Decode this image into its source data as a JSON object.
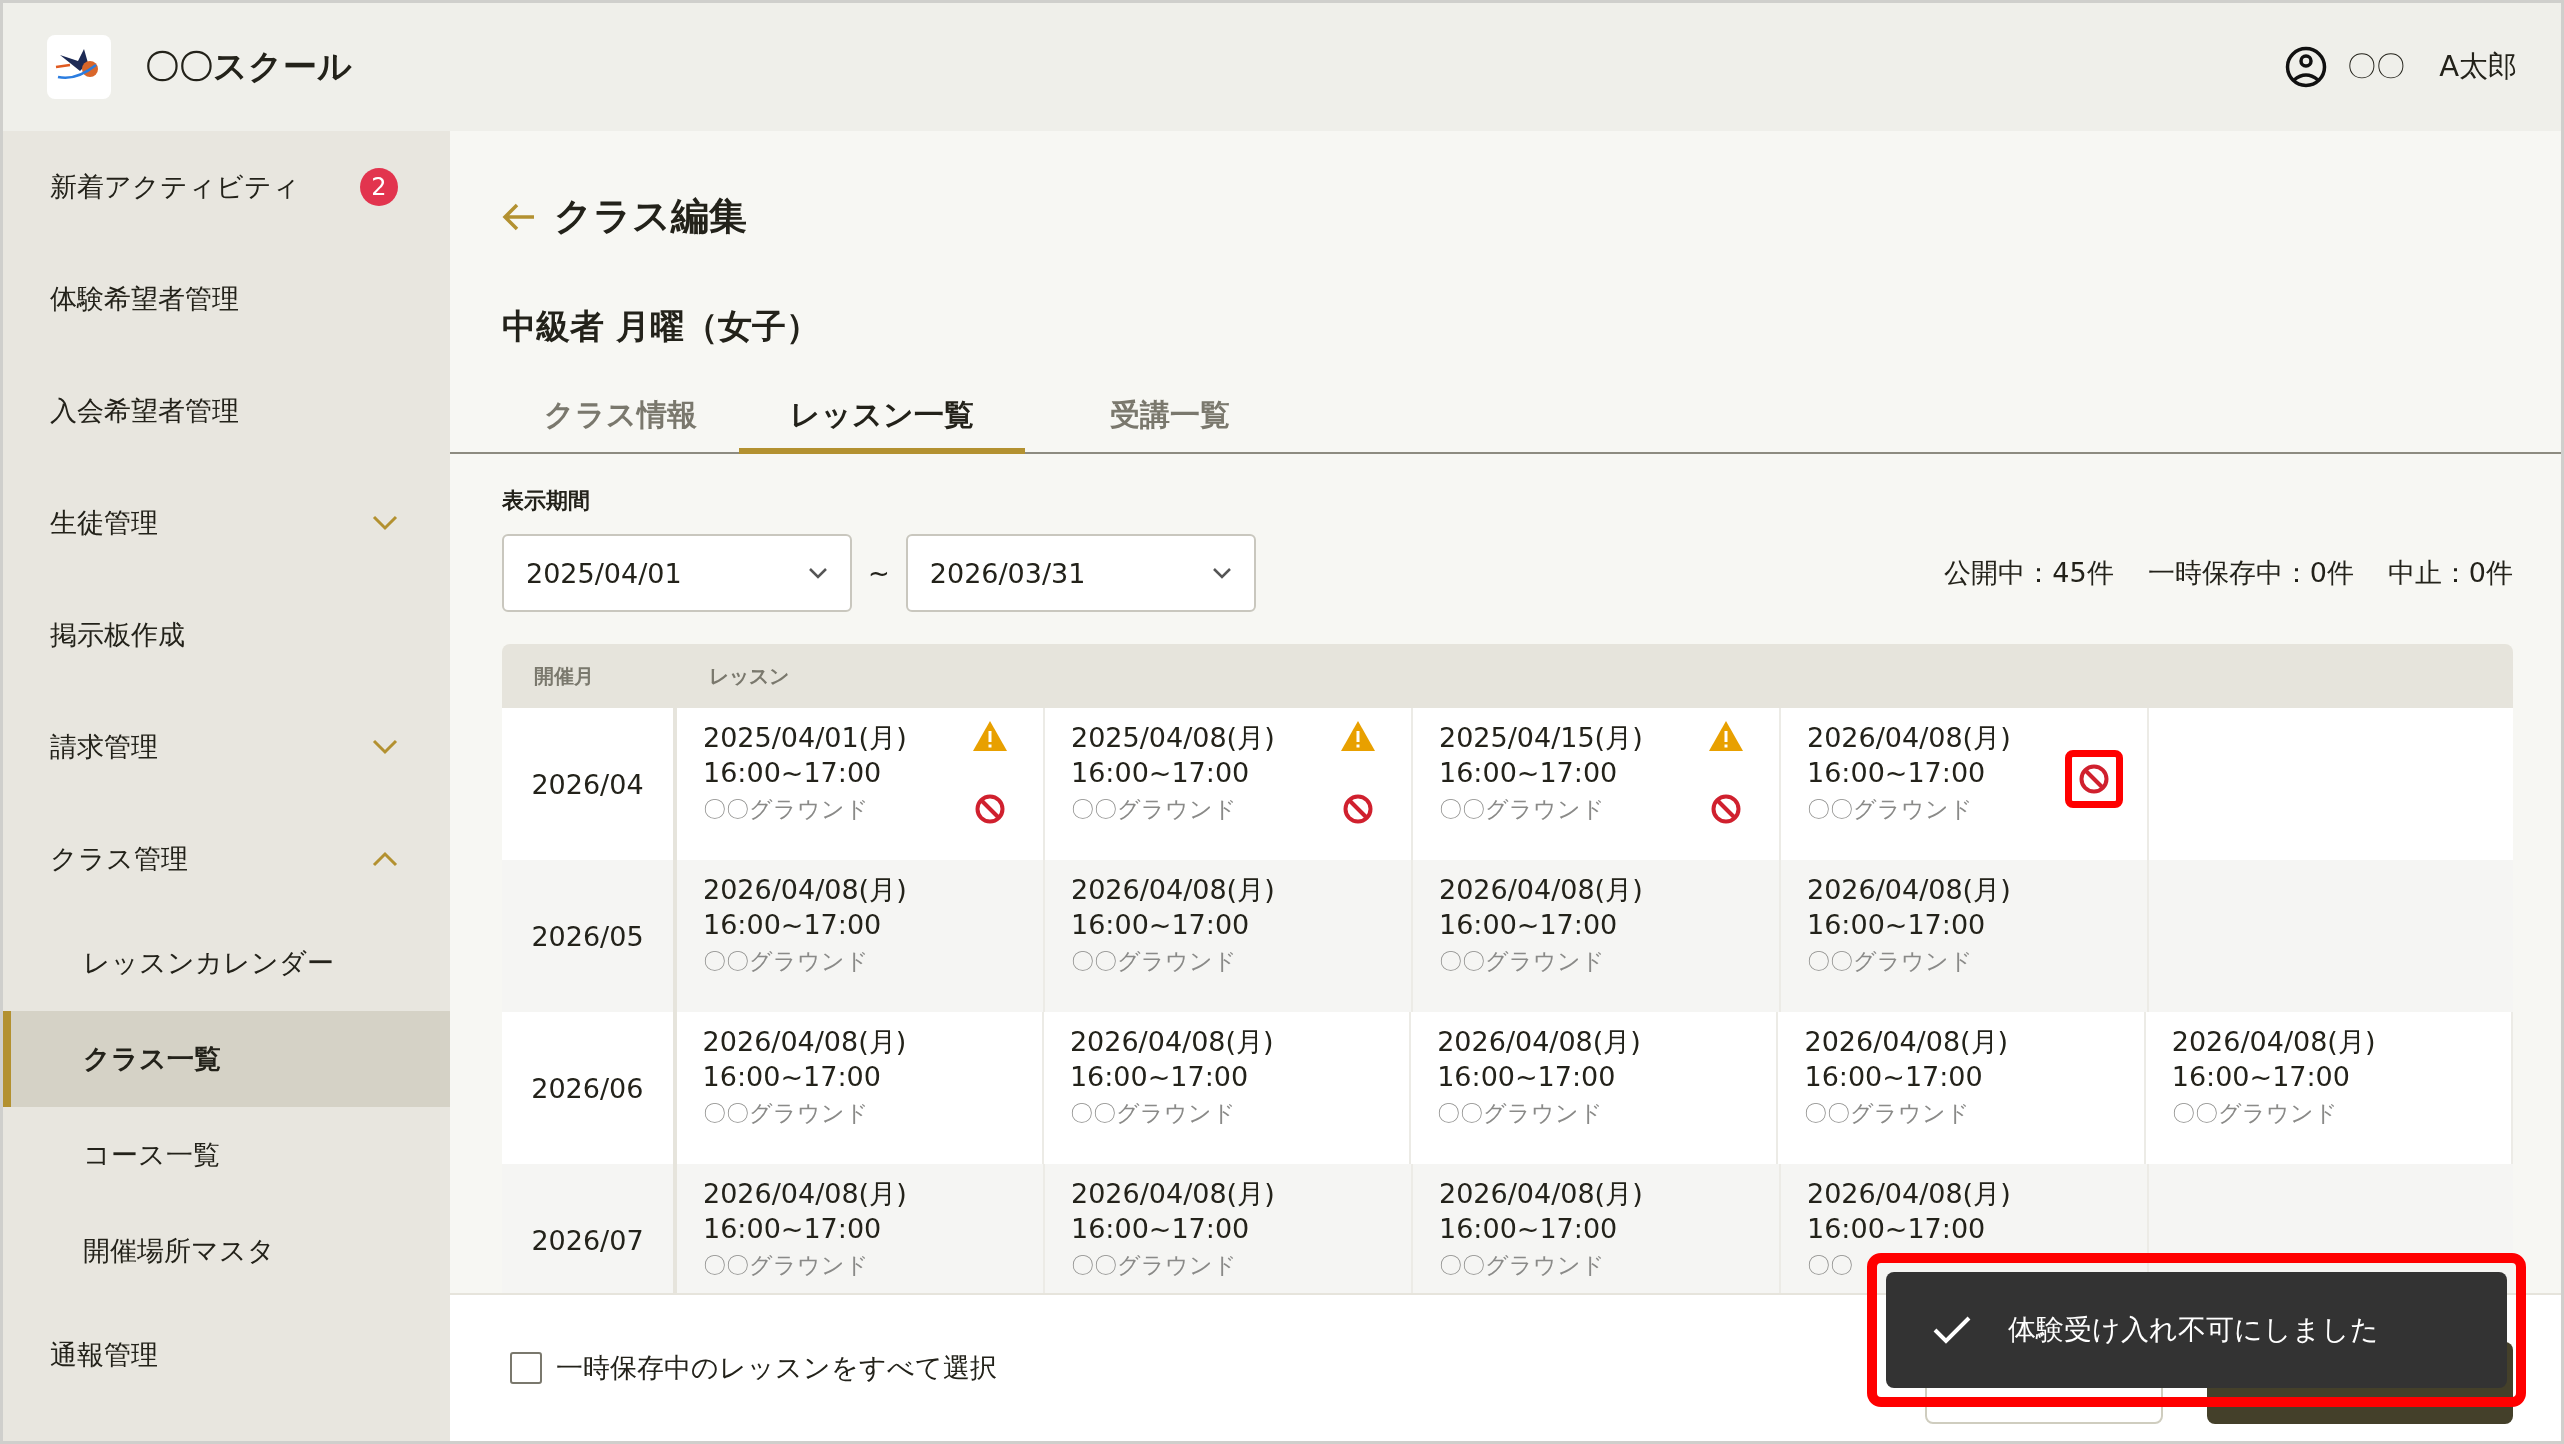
{
  "header": {
    "school_name": "〇〇スクール",
    "user_org": "〇〇",
    "user_name": "A太郎"
  },
  "sidebar": {
    "items": [
      {
        "label": "新着アクティビティ",
        "badge": "2",
        "selected": false
      },
      {
        "label": "体験希望者管理",
        "selected": false
      },
      {
        "label": "入会希望者管理",
        "selected": false
      },
      {
        "label": "生徒管理",
        "expanded": false,
        "selected": false
      },
      {
        "label": "掲示板作成",
        "selected": false
      },
      {
        "label": "請求管理",
        "expanded": false,
        "selected": false
      },
      {
        "label": "クラス管理",
        "expanded": true,
        "selected": false,
        "children": [
          {
            "label": "レッスンカレンダー",
            "selected": false
          },
          {
            "label": "クラス一覧",
            "selected": true
          },
          {
            "label": "コース一覧",
            "selected": false
          },
          {
            "label": "開催場所マスタ",
            "selected": false
          }
        ]
      },
      {
        "label": "通報管理",
        "selected": false
      }
    ]
  },
  "page": {
    "title": "クラス編集",
    "class_name": "中級者 月曜（女子）",
    "tabs": [
      {
        "label": "クラス情報",
        "selected": false
      },
      {
        "label": "レッスン一覧",
        "selected": true
      },
      {
        "label": "受講一覧",
        "selected": false
      }
    ],
    "period": {
      "label": "表示期間",
      "from": "2025/04/01",
      "separator": "~",
      "to": "2026/03/31"
    },
    "counts": [
      "公開中：45件",
      "一時保存中：0件",
      "中止：0件"
    ],
    "table": {
      "columns": [
        "開催月",
        "レッスン"
      ],
      "rows": [
        {
          "month": "2026/04",
          "lessons": [
            {
              "date": "2025/04/01(月)",
              "time": "16:00~17:00",
              "place": "〇〇グラウンド",
              "warning": true,
              "blocked": true,
              "highlighted": false
            },
            {
              "date": "2025/04/08(月)",
              "time": "16:00~17:00",
              "place": "〇〇グラウンド",
              "warning": true,
              "blocked": true,
              "highlighted": false
            },
            {
              "date": "2025/04/15(月)",
              "time": "16:00~17:00",
              "place": "〇〇グラウンド",
              "warning": true,
              "blocked": true,
              "highlighted": false
            },
            {
              "date": "2026/04/08(月)",
              "time": "16:00~17:00",
              "place": "〇〇グラウンド",
              "warning": false,
              "blocked": true,
              "highlighted": true
            }
          ]
        },
        {
          "month": "2026/05",
          "lessons": [
            {
              "date": "2026/04/08(月)",
              "time": "16:00~17:00",
              "place": "〇〇グラウンド",
              "warning": false,
              "blocked": false,
              "highlighted": false
            },
            {
              "date": "2026/04/08(月)",
              "time": "16:00~17:00",
              "place": "〇〇グラウンド",
              "warning": false,
              "blocked": false,
              "highlighted": false
            },
            {
              "date": "2026/04/08(月)",
              "time": "16:00~17:00",
              "place": "〇〇グラウンド",
              "warning": false,
              "blocked": false,
              "highlighted": false
            },
            {
              "date": "2026/04/08(月)",
              "time": "16:00~17:00",
              "place": "〇〇グラウンド",
              "warning": false,
              "blocked": false,
              "highlighted": false
            }
          ]
        },
        {
          "month": "2026/06",
          "lessons": [
            {
              "date": "2026/04/08(月)",
              "time": "16:00~17:00",
              "place": "〇〇グラウンド",
              "warning": false,
              "blocked": false,
              "highlighted": false
            },
            {
              "date": "2026/04/08(月)",
              "time": "16:00~17:00",
              "place": "〇〇グラウンド",
              "warning": false,
              "blocked": false,
              "highlighted": false
            },
            {
              "date": "2026/04/08(月)",
              "time": "16:00~17:00",
              "place": "〇〇グラウンド",
              "warning": false,
              "blocked": false,
              "highlighted": false
            },
            {
              "date": "2026/04/08(月)",
              "time": "16:00~17:00",
              "place": "〇〇グラウンド",
              "warning": false,
              "blocked": false,
              "highlighted": false
            },
            {
              "date": "2026/04/08(月)",
              "time": "16:00~17:00",
              "place": "〇〇グラウンド",
              "warning": false,
              "blocked": false,
              "highlighted": false
            }
          ]
        },
        {
          "month": "2026/07",
          "lessons": [
            {
              "date": "2026/04/08(月)",
              "time": "16:00~17:00",
              "place": "〇〇グラウンド",
              "warning": false,
              "blocked": false,
              "highlighted": false
            },
            {
              "date": "2026/04/08(月)",
              "time": "16:00~17:00",
              "place": "〇〇グラウンド",
              "warning": false,
              "blocked": false,
              "highlighted": false
            },
            {
              "date": "2026/04/08(月)",
              "time": "16:00~17:00",
              "place": "〇〇グラウンド",
              "warning": false,
              "blocked": false,
              "highlighted": false
            },
            {
              "date": "2026/04/08(月)",
              "time": "16:00~17:00",
              "place": "〇〇",
              "warning": false,
              "blocked": false,
              "highlighted": false
            }
          ]
        }
      ]
    },
    "footer": {
      "select_all": {
        "label": "一時保存中のレッスンをすべて選択",
        "checked": false
      }
    },
    "toast": {
      "message": "体験受け入れ不可にしました",
      "highlighted": true
    }
  }
}
